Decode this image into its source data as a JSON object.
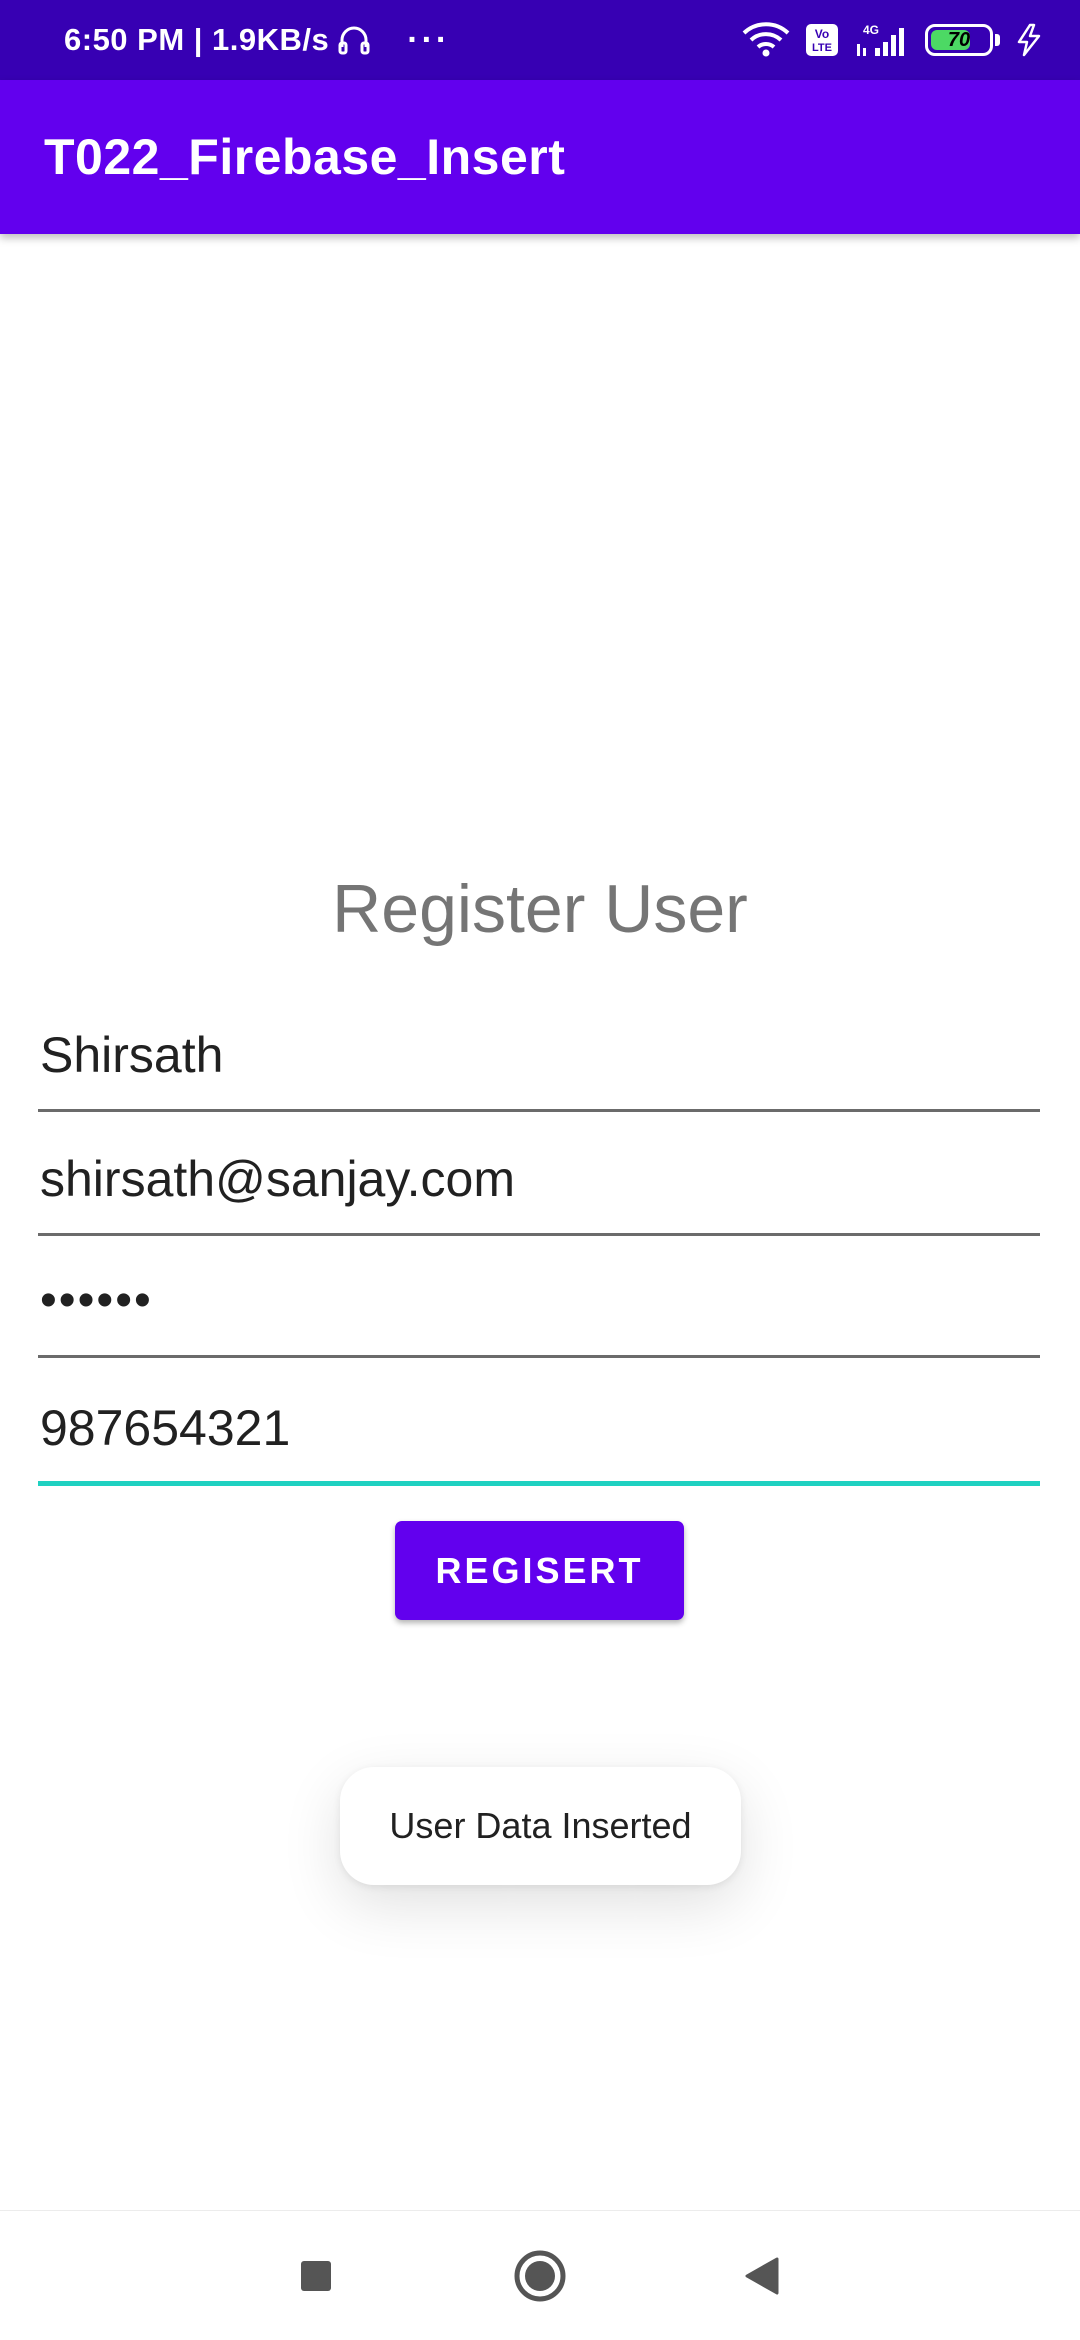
{
  "status_bar": {
    "time_speed": "6:50 PM | 1.9KB/s",
    "more": "···",
    "volte": "Vo\nLTE",
    "network": "4G",
    "battery_level": "70",
    "battery_fraction": 0.7
  },
  "app_bar": {
    "title": "T022_Firebase_Insert"
  },
  "form": {
    "title": "Register User",
    "name_value": "Shirsath",
    "email_value": "shirsath@sanjay.com",
    "password_value": "••••••",
    "phone_value": "987654321",
    "register_label": "REGISERT"
  },
  "toast": {
    "message": "User Data Inserted"
  },
  "colors": {
    "status_bar": "#3700B3",
    "primary": "#6200EE",
    "accent": "#1FD1C1",
    "title_gray": "#757575"
  },
  "nav_bar": {
    "icons": [
      "recents-square-icon",
      "home-circle-icon",
      "back-triangle-icon"
    ]
  }
}
